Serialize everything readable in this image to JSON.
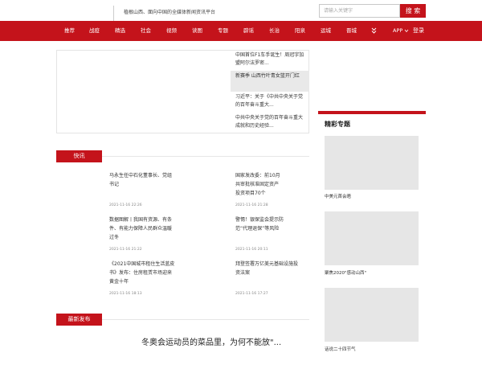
{
  "header": {
    "slogan": "植根山西、面向中国的全媒体新闻资讯平台",
    "search_placeholder": "请输入关键字",
    "search_button": "搜 索"
  },
  "nav": {
    "items": [
      "推荐",
      "战疫",
      "精选",
      "社会",
      "视频",
      "读图",
      "专题",
      "辟谣",
      "长治",
      "阳泉",
      "运城",
      "晋城"
    ],
    "more_icon": "double-chevron-down-icon",
    "app_label": "APP",
    "app_icon": "chevron-down-icon",
    "login_label": "登录"
  },
  "feature": {
    "items": [
      "中国首位F1车手诞生！周冠宇加盟阿尔法罗密...",
      "新赛季 山西竹叶青女篮开门红",
      "习近平：关于《中共中央关于党的百年奋斗重大...",
      "中共中央关于党的百年奋斗重大成就和历史经验..."
    ]
  },
  "flash": {
    "heading": "快讯",
    "items": [
      {
        "title": "马永生任中石化董事长、党组书记",
        "time": "2021-11-16 22:26"
      },
      {
        "title": "国家发改委：前10月共审批核准固定资产投资项目70个",
        "time": "2021-11-16 21:28"
      },
      {
        "title": "数据图解丨我国有资源、有条件、有能力保障人民群众温暖过冬",
        "time": "2021-11-16 21:22"
      },
      {
        "title": "警惕！银保监会提示防范“代理退保”等风险",
        "time": "2021-11-16 20:11"
      },
      {
        "title": "《2021中国城市租住生活蓝皮书》发布：住房租赁市场迎来黄金十年",
        "time": "2021-11-16 18:13"
      },
      {
        "title": "拜登签署万亿美元基础设施投资法案",
        "time": "2021-11-16 17:27"
      }
    ]
  },
  "latest": {
    "heading": "最新发布",
    "headline": "冬奥会运动员的菜品里，为何不能放\"..."
  },
  "sidebar": {
    "title": "精彩专题",
    "items": [
      "中美元首会晤",
      "聚焦2020\"感动山西\"",
      "话说二十四节气"
    ]
  }
}
